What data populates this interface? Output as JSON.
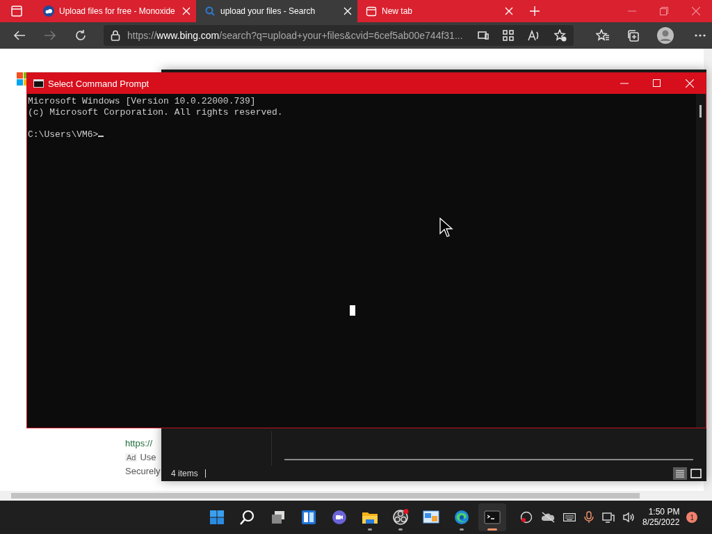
{
  "browser": {
    "tabs": [
      {
        "title": "Upload files for free - Monoxide",
        "selected": false
      },
      {
        "title": "upload your files - Search",
        "selected": true
      },
      {
        "title": "New tab",
        "selected": false
      }
    ],
    "url": "https://**www.bing.com**/search?q=upload+your+files&cvid=6cef5ab00e744f31...",
    "page": {
      "result_url": "https://",
      "ad_label": "Ad",
      "ad_text": "Use",
      "snippet": "Securely"
    }
  },
  "explorer": {
    "status": "4 items"
  },
  "cmd": {
    "title": "Select Command Prompt",
    "lines": [
      "Microsoft Windows [Version 10.0.22000.739]",
      "(c) Microsoft Corporation. All rights reserved."
    ],
    "prompt": "C:\\Users\\VM6>"
  },
  "taskbar": {
    "apps": [
      {
        "kind": "start",
        "running": false,
        "active": false
      },
      {
        "kind": "search",
        "running": false,
        "active": false
      },
      {
        "kind": "taskview",
        "running": false,
        "active": false
      },
      {
        "kind": "widgets",
        "running": false,
        "active": false
      },
      {
        "kind": "chat",
        "running": false,
        "active": false
      },
      {
        "kind": "folder",
        "running": true,
        "active": false
      },
      {
        "kind": "recorder",
        "running": true,
        "active": false
      },
      {
        "kind": "remote",
        "running": false,
        "active": false
      },
      {
        "kind": "edge",
        "running": true,
        "active": false
      },
      {
        "kind": "terminal",
        "running": true,
        "active": true
      }
    ],
    "time": "1:50 PM",
    "date": "8/25/2022",
    "notifications": "1"
  }
}
